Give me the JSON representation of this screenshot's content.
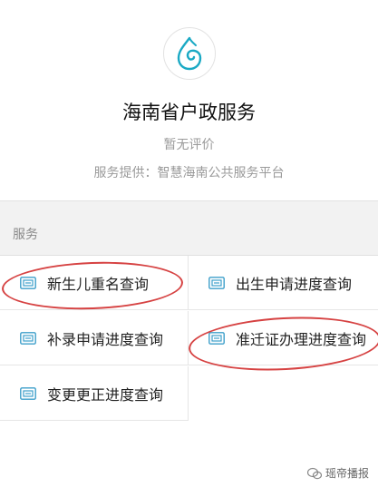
{
  "header": {
    "title": "海南省户政服务",
    "rating": "暂无评价",
    "provider": "服务提供：智慧海南公共服务平台"
  },
  "section": {
    "label": "服务"
  },
  "services": [
    {
      "label": "新生儿重名查询"
    },
    {
      "label": "出生申请进度查询"
    },
    {
      "label": "补录申请进度查询"
    },
    {
      "label": "准迁证办理进度查询"
    },
    {
      "label": "变更更正进度查询"
    }
  ],
  "watermark": {
    "text": "瑶帝播报"
  },
  "colors": {
    "annotation": "#d64242",
    "logo": "#1aa9c4",
    "icon": "#3d9fca"
  }
}
